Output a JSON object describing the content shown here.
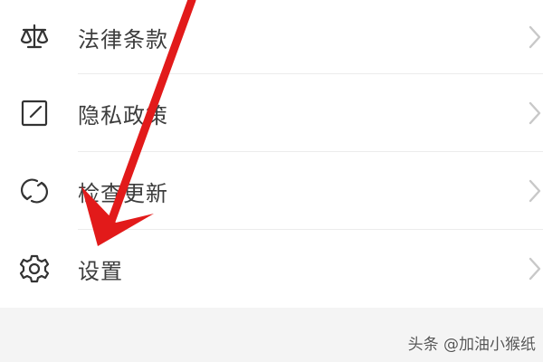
{
  "menu": {
    "items": [
      {
        "label": "法律条款",
        "icon": "scale-icon"
      },
      {
        "label": "隐私政策",
        "icon": "edit-square-icon"
      },
      {
        "label": "检查更新",
        "icon": "refresh-icon"
      },
      {
        "label": "设置",
        "icon": "gear-icon"
      }
    ]
  },
  "watermark": {
    "text": "头条 @加油小猴纸"
  },
  "colors": {
    "accent": "#e21a1a",
    "text": "#3d3d3d",
    "icon": "#333333",
    "chevron": "#c8c8c8",
    "footer_bg": "#f4f4f4"
  }
}
